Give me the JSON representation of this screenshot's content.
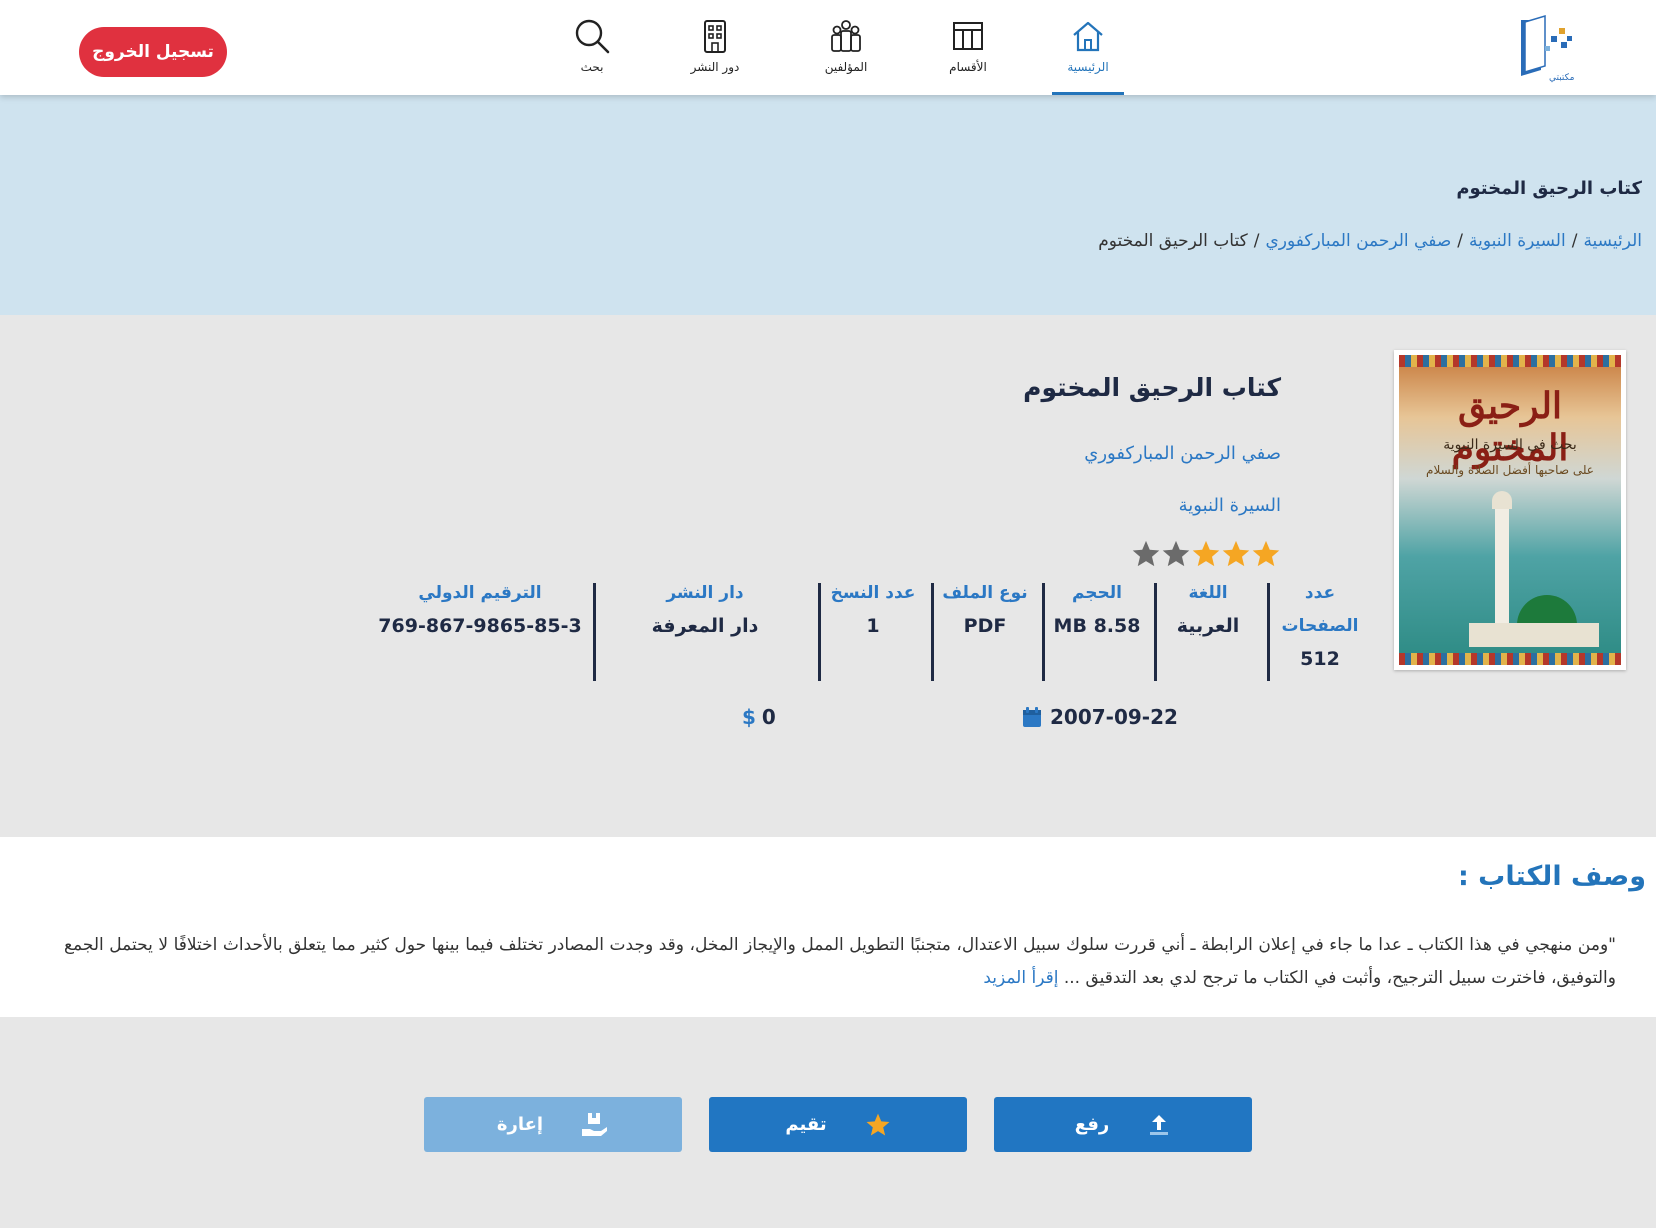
{
  "nav": {
    "logout_label": "تسجيل الخروج",
    "items": [
      {
        "label": "بحث",
        "icon": "search-icon"
      },
      {
        "label": "دور النشر",
        "icon": "building-icon"
      },
      {
        "label": "المؤلفين",
        "icon": "authors-icon"
      },
      {
        "label": "الأقسام",
        "icon": "sections-icon"
      },
      {
        "label": "الرئيسية",
        "icon": "home-icon",
        "active": true
      }
    ],
    "logo_text": "مكتبتي"
  },
  "hero": {
    "title": "كتاب الرحيق المختوم",
    "breadcrumb": [
      "الرئيسية",
      "السيرة النبوية",
      "صفي الرحمن المباركفوري",
      "كتاب الرحيق المختوم"
    ]
  },
  "book": {
    "title": "كتاب الرحيق المختوم",
    "author": "صفي الرحمن المباركفوري",
    "category": "السيرة النبوية",
    "rating": 3,
    "rating_max": 5,
    "cover": {
      "title": "الرحيق المختوم",
      "subtitle": "بحث في السيرة النبوية",
      "subtitle2": "على صاحبها أفضل الصلاة والسلام"
    },
    "meta": [
      {
        "label": "عدد الصفحات",
        "value": "512"
      },
      {
        "label": "اللغة",
        "value": "العربية"
      },
      {
        "label": "الحجم",
        "value": "8.58 MB"
      },
      {
        "label": "نوع الملف",
        "value": "PDF"
      },
      {
        "label": "عدد النسخ",
        "value": "1"
      },
      {
        "label": "دار النشر",
        "value": "دار المعرفة"
      },
      {
        "label": "الترقيم الدولي",
        "value": "769-867-9865-85-3"
      }
    ],
    "date": "2007-09-22",
    "price": "0",
    "currency": "$"
  },
  "description": {
    "heading": "وصف الكتاب :",
    "text": "\"ومن منهجي في هذا الكتاب ـ عدا ما جاء في إعلان الرابطة ـ أني قررت سلوك سبيل الاعتدال، متجنبًا التطويل الممل والإيجاز المخل، وقد وجدت المصادر تختلف فيما بينها حول كثير مما يتعلق بالأحداث اختلافًا لا يحتمل الجمع والتوفيق، فاخترت سبيل الترجيح، وأثبت في الكتاب ما ترجح لدي بعد التدقيق ...",
    "more": "إقرأ المزيد"
  },
  "actions": {
    "upload": "رفع",
    "rate": "تقيم",
    "lend": "إعارة"
  },
  "colors": {
    "accent": "#2374ba",
    "logout": "#e0313f",
    "hero_bg": "#cfe3ef",
    "star_on": "#f5a623",
    "star_off": "#6b6b6b"
  }
}
